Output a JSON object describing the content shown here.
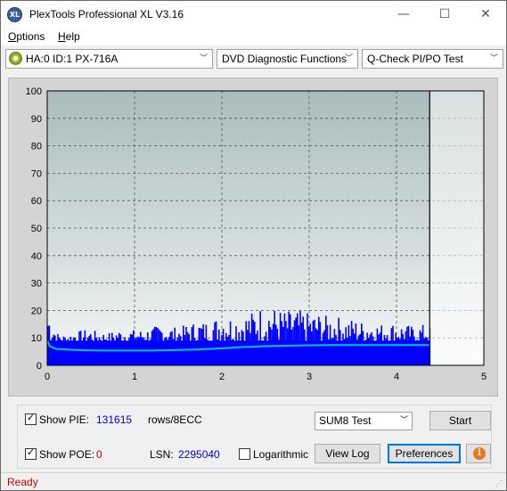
{
  "window": {
    "title": "PlexTools Professional XL V3.16",
    "icon_text": "XL",
    "minimize_glyph": "—",
    "maximize_glyph": "☐",
    "close_glyph": "✕"
  },
  "menu": {
    "options_accel": "O",
    "options_rest": "ptions",
    "help_accel": "H",
    "help_rest": "elp"
  },
  "toolbar": {
    "drive": "HA:0 ID:1  PX-716A",
    "function": "DVD Diagnostic Functions",
    "test": "Q-Check PI/PO Test",
    "arrow": "﹀"
  },
  "chart_data": {
    "type": "area",
    "xlim": [
      0,
      5
    ],
    "ylim": [
      0,
      100
    ],
    "x_ticks": [
      "0",
      "1",
      "2",
      "3",
      "4",
      "5"
    ],
    "y_ticks": [
      "0",
      "10",
      "20",
      "30",
      "40",
      "50",
      "60",
      "70",
      "80",
      "90",
      "100"
    ],
    "grid": true,
    "end_marker_x": 4.38,
    "series": [
      {
        "kind": "bars",
        "color": "#0000ff",
        "x": [
          0.0,
          0.1,
          0.2,
          0.3,
          0.4,
          0.5,
          0.6,
          0.7,
          0.8,
          0.9,
          1.0,
          1.1,
          1.2,
          1.3,
          1.4,
          1.5,
          1.6,
          1.7,
          1.8,
          1.9,
          2.0,
          2.1,
          2.2,
          2.3,
          2.4,
          2.5,
          2.6,
          2.7,
          2.8,
          2.9,
          3.0,
          3.1,
          3.2,
          3.3,
          3.4,
          3.5,
          3.6,
          3.7,
          3.8,
          3.9,
          4.0,
          4.1,
          4.2,
          4.3,
          4.38
        ],
        "values": [
          21,
          12,
          11,
          12,
          13,
          13,
          12,
          12,
          13,
          13,
          13,
          13,
          14,
          15,
          14,
          14,
          15,
          16,
          16,
          17,
          19,
          18,
          18,
          19,
          21,
          22,
          21,
          20,
          20,
          20,
          19,
          19,
          18,
          18,
          17,
          17,
          16,
          16,
          15,
          16,
          15,
          15,
          14,
          15,
          14
        ]
      },
      {
        "kind": "line",
        "color": "#00c8c8",
        "x": [
          0.0,
          0.03,
          0.1,
          0.2,
          0.4,
          0.6,
          0.8,
          1.0,
          1.2,
          1.5,
          1.8,
          2.0,
          2.2,
          2.5,
          2.8,
          3.0,
          3.3,
          3.6,
          4.0,
          4.38
        ],
        "values": [
          9,
          7,
          6,
          5.8,
          5.5,
          5.4,
          5.4,
          5.4,
          5.4,
          5.6,
          5.9,
          6.2,
          6.6,
          7.0,
          7.2,
          7.3,
          7.4,
          7.4,
          7.4,
          7.4
        ]
      }
    ]
  },
  "controls": {
    "show_pie_label": "Show PIE:",
    "show_pie_value": "131615",
    "rows_label": "rows/8ECC",
    "show_poe_label": "Show POE:",
    "show_poe_value": "0",
    "lsn_label": "LSN:",
    "lsn_value": "2295040",
    "logarithmic_label": "Logarithmic",
    "test_select": "SUM8 Test",
    "start_label": "Start",
    "view_log_label": "View Log",
    "preferences_label": "Preferences",
    "info_glyph": "i",
    "check_glyph": "✓"
  },
  "status": {
    "text": "Ready"
  },
  "colors": {
    "plot_top": "#a9bcbc",
    "plot_bottom": "#f4f7f7",
    "pie_bars": "#0000ff",
    "poe_line": "#00c8c8"
  }
}
